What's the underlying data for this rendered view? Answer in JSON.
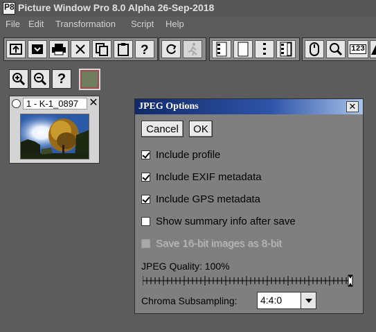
{
  "window": {
    "app_icon_text": "P8",
    "title": "Picture Window Pro 8.0 Alpha 26-Sep-2018"
  },
  "menu": [
    "File",
    "Edit",
    "Transformation",
    "Script",
    "Help"
  ],
  "toolbar": {
    "icons": [
      "open-icon",
      "save-icon",
      "print-icon",
      "close-icon",
      "copy-icon",
      "paste-icon",
      "help-icon",
      "refresh-icon",
      "run-script-icon",
      "layout-2-panel-icon",
      "layout-1-panel-icon",
      "layout-dots-icon",
      "layout-list-icon",
      "mouse-icon",
      "magnifier-icon",
      "info-123-icon",
      "histogram-icon"
    ],
    "info_label": "123"
  },
  "mini_tools": {
    "help_label": "?",
    "icons": [
      "zoom-in-icon",
      "zoom-out-icon",
      "help-icon",
      "color-swatch-icon"
    ]
  },
  "thumbnail": {
    "label": "1 - K-1_0897",
    "close_label": "✕"
  },
  "dialog": {
    "title": "JPEG Options",
    "close_label": "✕",
    "cancel_label": "Cancel",
    "ok_label": "OK",
    "options": [
      {
        "label": "Include profile",
        "checked": true,
        "enabled": true
      },
      {
        "label": "Include EXIF metadata",
        "checked": true,
        "enabled": true
      },
      {
        "label": "Include GPS metadata",
        "checked": true,
        "enabled": true
      },
      {
        "label": "Show summary info after save",
        "checked": false,
        "enabled": true
      },
      {
        "label": "Save 16-bit images as 8-bit",
        "checked": false,
        "enabled": false
      }
    ],
    "quality_label": "JPEG Quality: 100%",
    "quality_value": 100,
    "chroma_label": "Chroma Subsampling:",
    "chroma_value": "4:4:0"
  },
  "colors": {
    "background": "#5c5c5c",
    "dialog_bg": "#7f7f7f",
    "dialog_title_start": "#102a68",
    "dialog_title_end": "#a7c3ea",
    "swatch_inner": "#6f7d60",
    "swatch_outer": "#a24a4a"
  }
}
